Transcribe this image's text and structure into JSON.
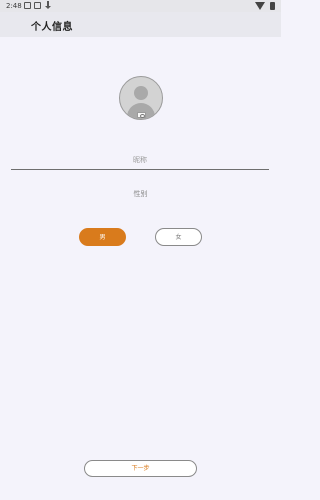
{
  "status_bar": {
    "time": "2:48",
    "icons": [
      "notification-icon",
      "notification-icon",
      "download-icon",
      "wifi-icon",
      "battery-icon"
    ]
  },
  "app_bar": {
    "title": "个人信息"
  },
  "profile": {
    "avatar_icon": "default-avatar-icon",
    "camera_icon": "camera-icon"
  },
  "form": {
    "nickname_placeholder": "昵称",
    "nickname_value": "",
    "gender_label": "性别",
    "male_label": "男",
    "female_label": "女",
    "selected_gender": "男",
    "next_label": "下一步"
  },
  "colors": {
    "accent": "#d97b1c",
    "background": "#f4f3fb",
    "app_bar": "#e8e8ee"
  }
}
